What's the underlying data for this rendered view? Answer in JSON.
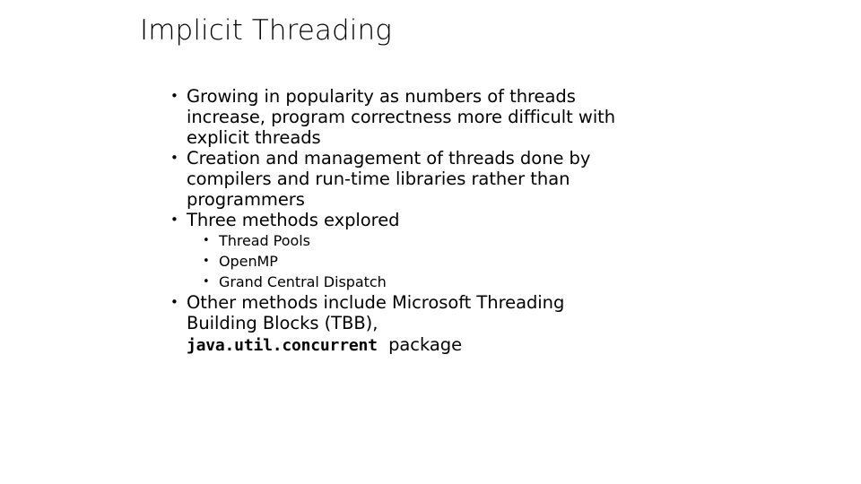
{
  "slide": {
    "title": "Implicit Threading",
    "background_color": "#ffffff",
    "text_color": "#000000",
    "bullet_marker": "•",
    "bullets": [
      {
        "level": 1,
        "text": "Growing in popularity as numbers of threads increase, program correctness more difficult with explicit threads"
      },
      {
        "level": 1,
        "text": "Creation and management of threads done by compilers and run-time libraries rather than programmers"
      },
      {
        "level": 1,
        "text": "Three methods explored"
      },
      {
        "level": 2,
        "text": "Thread Pools"
      },
      {
        "level": 2,
        "text": "OpenMP"
      },
      {
        "level": 2,
        "text": "Grand Central Dispatch"
      },
      {
        "level": 1,
        "text": "Other methods include Microsoft Threading Building Blocks (TBB),",
        "code_text": "java.util.concurrent",
        "code_suffix": "package"
      }
    ]
  }
}
